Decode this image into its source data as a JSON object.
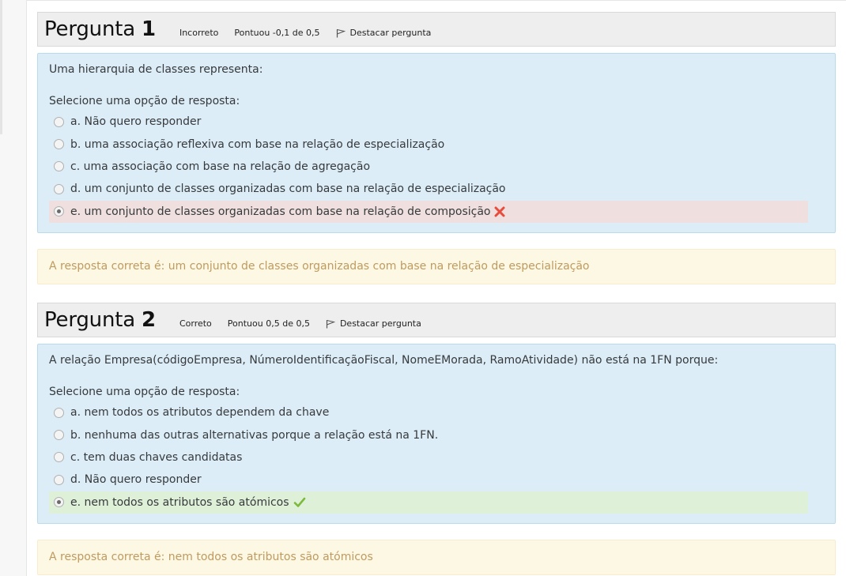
{
  "questions": [
    {
      "title_word": "Pergunta",
      "number": "1",
      "status": "Incorreto",
      "score": "Pontuou -0,1 de 0,5",
      "flag_label": "Destacar pergunta",
      "text": "Uma hierarquia de classes representa:",
      "prompt": "Selecione uma opção de resposta:",
      "answers": [
        "a. Não quero responder",
        "b. uma associação reflexiva com base na relação de especialização",
        "c. uma associação com base na relação de agregação",
        "d. um conjunto de classes organizadas com base na relação de especialização",
        "e. um conjunto de classes organizadas com base na relação de composição"
      ],
      "selected": "e",
      "result_icon": "cross-icon",
      "feedback": "A resposta correta é: um conjunto de classes organizadas com base na relação de especialização"
    },
    {
      "title_word": "Pergunta",
      "number": "2",
      "status": "Correto",
      "score": "Pontuou 0,5 de 0,5",
      "flag_label": "Destacar pergunta",
      "text": "A relação Empresa(códigoEmpresa, NúmeroIdentificaçãoFiscal, NomeEMorada, RamoAtividade) não está na 1FN porque:",
      "prompt": "Selecione uma opção de resposta:",
      "answers": [
        "a. nem todos os atributos dependem da chave",
        "b. nenhuma das outras alternativas porque a relação está na 1FN.",
        "c. tem duas chaves candidatas",
        "d. Não quero responder",
        "e. nem todos os atributos são atómicos"
      ],
      "selected": "e",
      "result_icon": "checkmark-icon",
      "feedback": "A resposta correta é: nem todos os atributos são atómicos"
    }
  ],
  "colors": {
    "header_bg": "#eeeeee",
    "question_bg": "#dcedf7",
    "incorrect_bg": "#efdfdf",
    "correct_bg": "#dff0d8",
    "feedback_bg": "#fcf8e3",
    "feedback_text": "#c09a5f",
    "cross": "#e84c3d",
    "check": "#7cba3d"
  }
}
